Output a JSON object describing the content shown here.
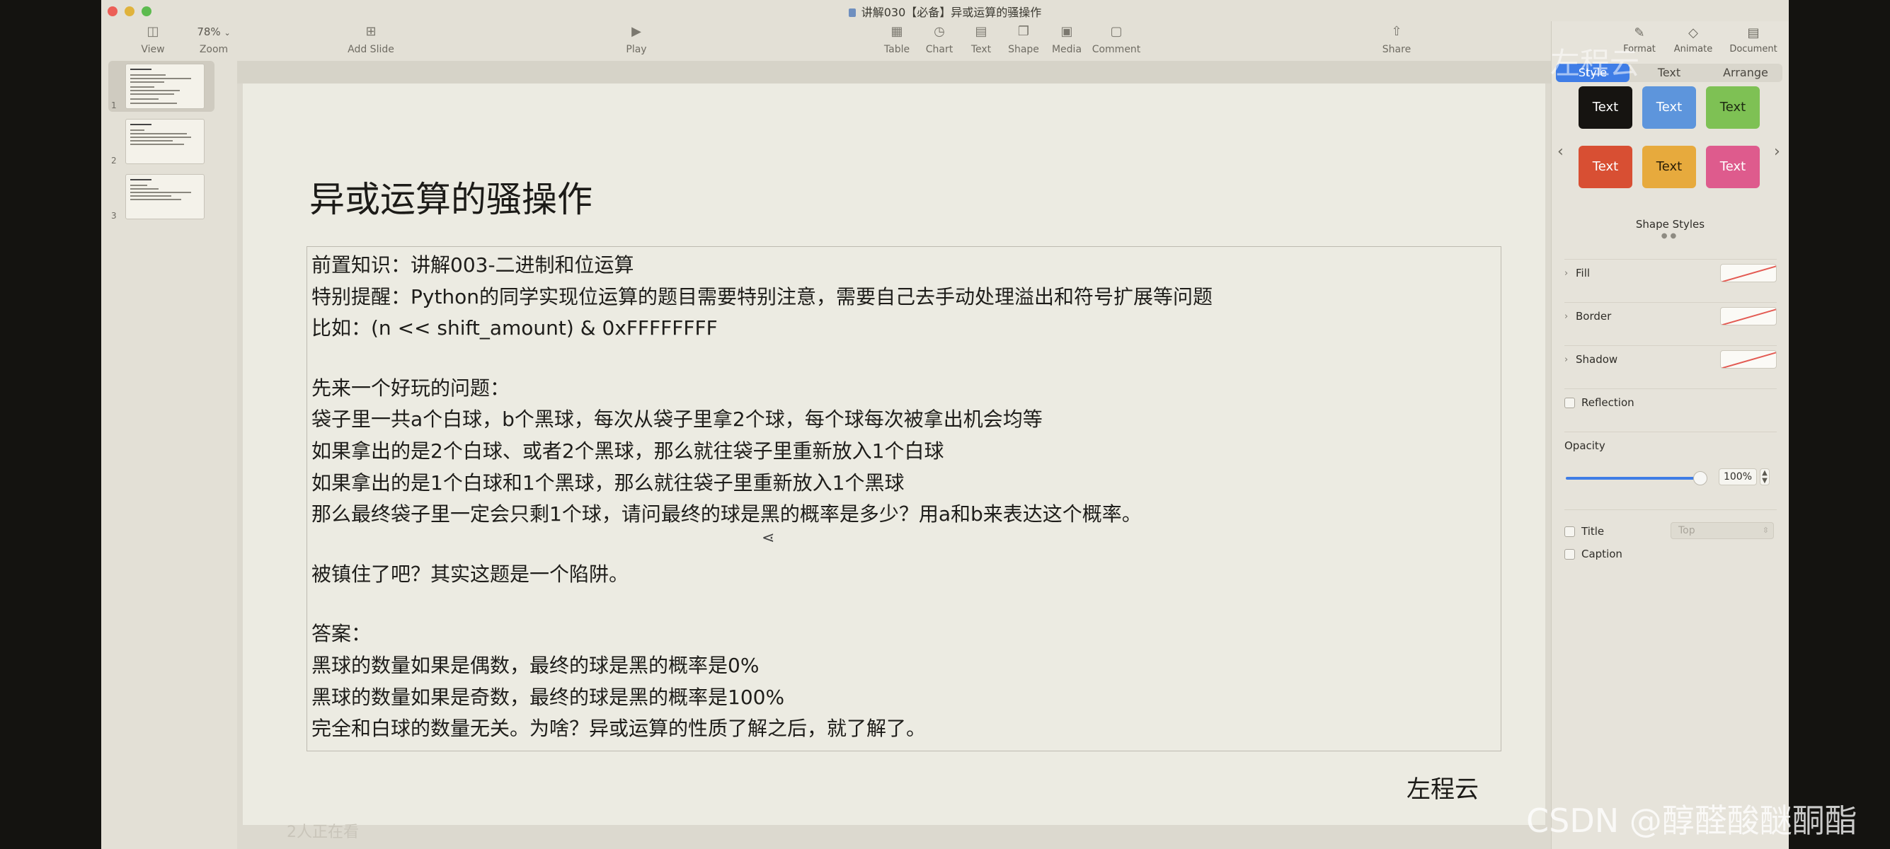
{
  "window": {
    "title": "讲解030【必备】异或运算的骚操作"
  },
  "toolbar": {
    "view": "View",
    "zoom_value": "78%",
    "zoom": "Zoom",
    "add_slide": "Add Slide",
    "play": "Play",
    "table": "Table",
    "chart": "Chart",
    "text": "Text",
    "shape": "Shape",
    "media": "Media",
    "comment": "Comment",
    "share": "Share"
  },
  "sidebar": {
    "slides": [
      {
        "number": "1"
      },
      {
        "number": "2"
      },
      {
        "number": "3"
      }
    ]
  },
  "slide": {
    "title": "异或运算的骚操作",
    "lines": [
      "前置知识：讲解003-二进制和位运算",
      "特别提醒：Python的同学实现位运算的题目需要特别注意，需要自己去手动处理溢出和符号扩展等问题",
      "比如：(n << shift_amount) & 0xFFFFFFFF",
      "",
      "先来一个好玩的问题：",
      "袋子里一共a个白球，b个黑球，每次从袋子里拿2个球，每个球每次被拿出机会均等",
      "如果拿出的是2个白球、或者2个黑球，那么就往袋子里重新放入1个白球",
      "如果拿出的是1个白球和1个黑球，那么就往袋子里重新放入1个黑球",
      "那么最终袋子里一定会只剩1个球，请问最终的球是黑的概率是多少？用a和b来表达这个概率。",
      "",
      "被镇住了吧？其实这题是一个陷阱。",
      "",
      "答案：",
      "黑球的数量如果是偶数，最终的球是黑的概率是0%",
      "黑球的数量如果是奇数，最终的球是黑的概率是100%",
      "完全和白球的数量无关。为啥？异或运算的性质了解之后，就了解了。"
    ],
    "signature": "左程云"
  },
  "canvas": {
    "viewers": "2人正在看"
  },
  "inspector": {
    "format": "Format",
    "animate": "Animate",
    "document": "Document",
    "tabs": [
      "Style",
      "Text",
      "Arrange"
    ],
    "swatches": [
      {
        "label": "Text",
        "bg": "#161411",
        "fg": "#ffffff"
      },
      {
        "label": "Text",
        "bg": "#5d95dc",
        "fg": "#ffffff"
      },
      {
        "label": "Text",
        "bg": "#7ec154",
        "fg": "#1d2a12"
      },
      {
        "label": "Text",
        "bg": "#d84f33",
        "fg": "#ffffff"
      },
      {
        "label": "Text",
        "bg": "#e7aa3d",
        "fg": "#2a1e07"
      },
      {
        "label": "Text",
        "bg": "#de5b8d",
        "fg": "#ffffff"
      }
    ],
    "shape_styles": "Shape Styles",
    "fill": "Fill",
    "border": "Border",
    "shadow": "Shadow",
    "reflection": "Reflection",
    "opacity_label": "Opacity",
    "opacity_value": "100%",
    "opacity_fraction": 1.0,
    "title_label": "Title",
    "title_position": "Top",
    "caption_label": "Caption"
  },
  "watermarks": {
    "top": "左程云",
    "bottom": "CSDN @醇醛酸醚酮酯"
  },
  "colors": {
    "accent": "#3f7de6",
    "no_fill_line": "#e35a52"
  }
}
